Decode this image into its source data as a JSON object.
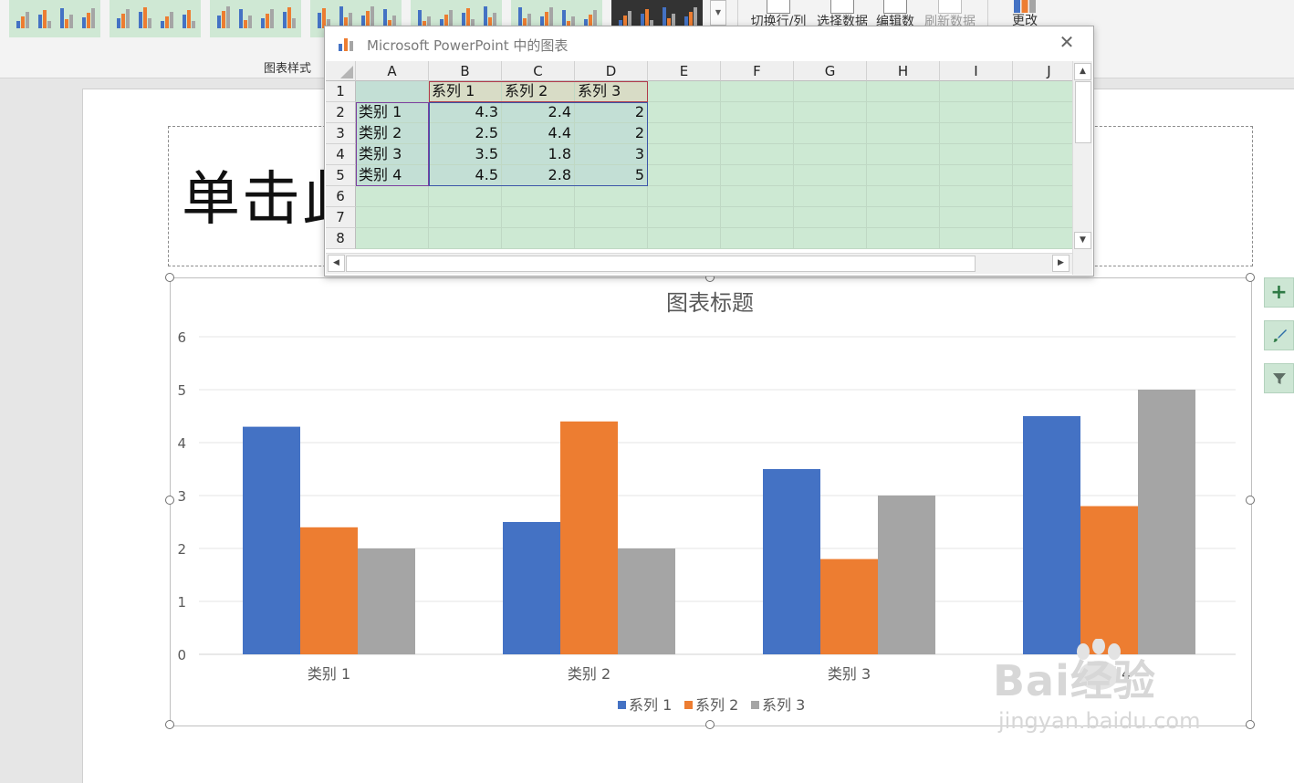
{
  "ribbon": {
    "group_label": "图表样式",
    "buttons": {
      "switch_row_col": "切换行/列",
      "select_data": "选择数据",
      "edit_data": "编辑数",
      "refresh_data": "刷新数据",
      "change": "更改"
    }
  },
  "slide": {
    "title_placeholder": "单击此"
  },
  "datasheet": {
    "title": "Microsoft PowerPoint 中的图表",
    "columns": [
      "A",
      "B",
      "C",
      "D",
      "E",
      "F",
      "G",
      "H",
      "I",
      "J"
    ],
    "rows": [
      "1",
      "2",
      "3",
      "4",
      "5",
      "6",
      "7",
      "8"
    ],
    "series_headers": [
      "系列 1",
      "系列 2",
      "系列 3"
    ],
    "data_rows": [
      {
        "category": "类别 1",
        "v1": "4.3",
        "v2": "2.4",
        "v3": "2"
      },
      {
        "category": "类别 2",
        "v1": "2.5",
        "v2": "4.4",
        "v3": "2"
      },
      {
        "category": "类别 3",
        "v1": "3.5",
        "v2": "1.8",
        "v3": "3"
      },
      {
        "category": "类别 4",
        "v1": "4.5",
        "v2": "2.8",
        "v3": "5"
      }
    ]
  },
  "chart_data": {
    "type": "bar",
    "title": "图表标题",
    "categories": [
      "类别 1",
      "类别 2",
      "类别 3",
      "类别 4"
    ],
    "series": [
      {
        "name": "系列 1",
        "values": [
          4.3,
          2.5,
          3.5,
          4.5
        ],
        "color": "#4472c4"
      },
      {
        "name": "系列 2",
        "values": [
          2.4,
          4.4,
          1.8,
          2.8
        ],
        "color": "#ed7d31"
      },
      {
        "name": "系列 3",
        "values": [
          2,
          2,
          3,
          5
        ],
        "color": "#a5a5a5"
      }
    ],
    "yticks": [
      "0",
      "1",
      "2",
      "3",
      "4",
      "5",
      "6"
    ],
    "ylim": [
      0,
      6
    ],
    "grid": true,
    "legend_position": "bottom"
  },
  "watermark": {
    "brand": "Bai经验",
    "url": "jingyan.baidu.com"
  }
}
